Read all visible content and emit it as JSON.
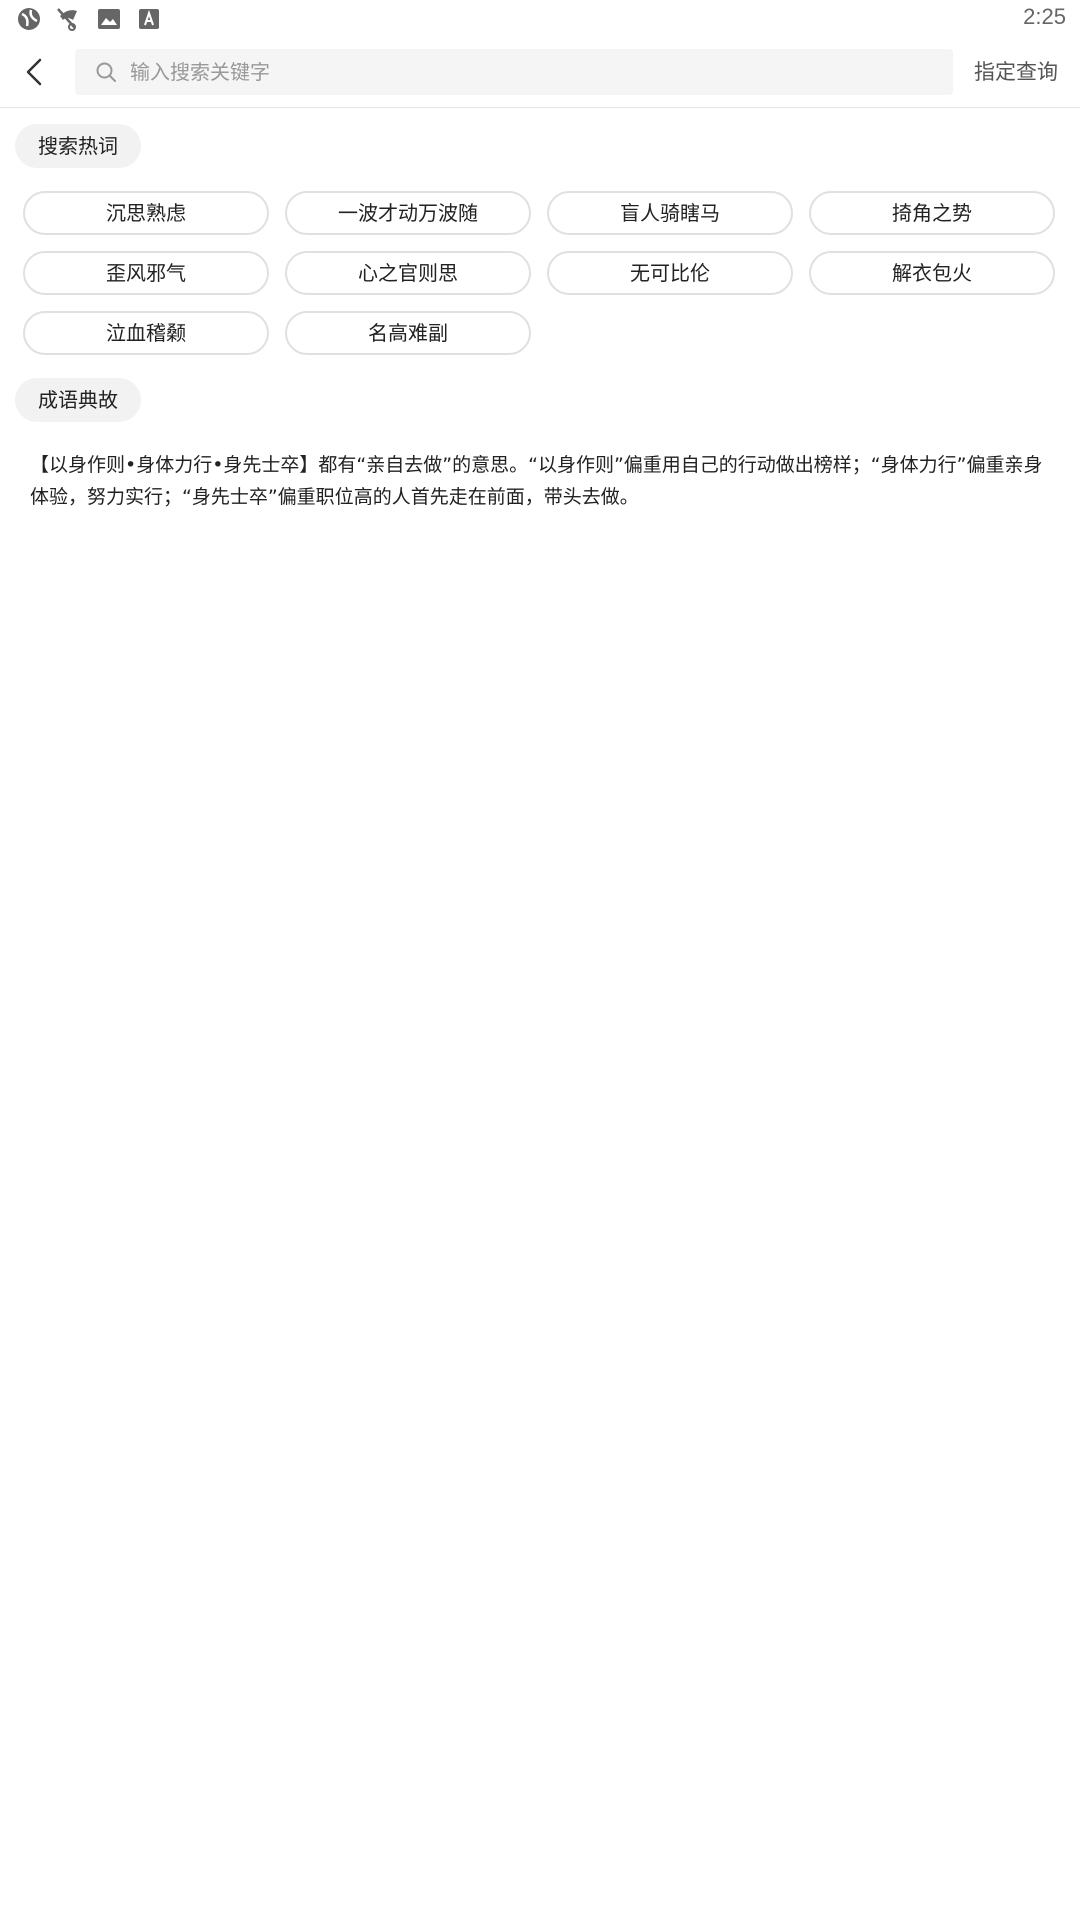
{
  "status_bar": {
    "time": "2:25",
    "icons": [
      "browser-icon",
      "signal-off-icon",
      "image-icon",
      "text-input-icon"
    ]
  },
  "header": {
    "search_placeholder": "输入搜索关键字",
    "search_value": "",
    "query_button": "指定查询"
  },
  "hot_words": {
    "label": "搜索热词",
    "items": [
      "沉思熟虑",
      "一波才动万波随",
      "盲人骑瞎马",
      "掎角之势",
      "歪风邪气",
      "心之官则思",
      "无可比伦",
      "解衣包火",
      "泣血稽颡",
      "名高难副"
    ]
  },
  "idiom_story": {
    "label": "成语典故",
    "text": "【以身作则•身体力行•身先士卒】都有“亲自去做”的意思。“以身作则”偏重用自己的行动做出榜样；“身体力行”偏重亲身体验，努力实行；“身先士卒”偏重职位高的人首先走在前面，带头去做。"
  },
  "colors": {
    "search_bg": "#f5f5f5",
    "tag_border": "#e0e0e0",
    "label_bg": "#f2f2f2"
  }
}
